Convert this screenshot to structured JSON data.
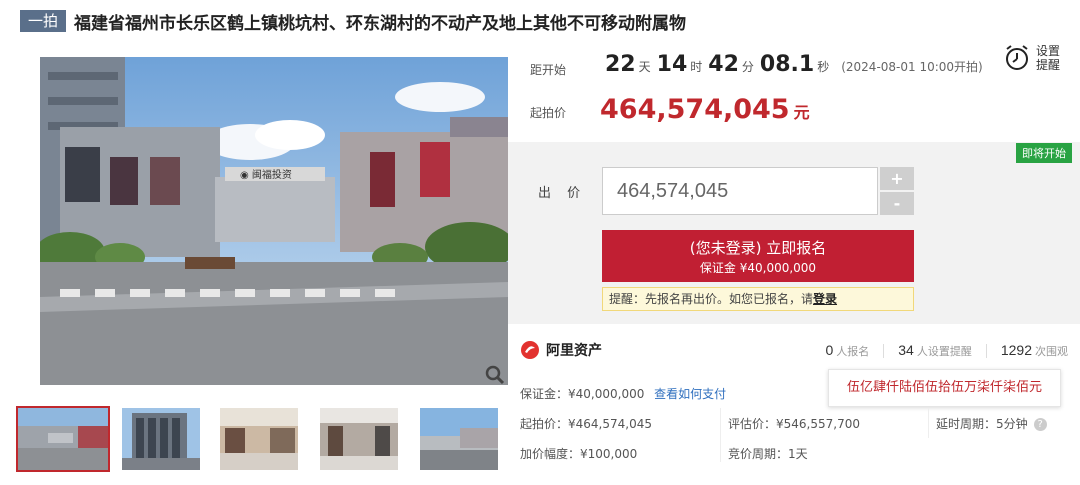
{
  "header": {
    "tag": "一拍",
    "title": "福建省福州市长乐区鹤上镇桃坑村、环东湖村的不动产及地上其他不可移动附属物"
  },
  "countdown": {
    "label": "距开始",
    "days": "22",
    "days_unit": "天",
    "hours": "14",
    "hours_unit": "时",
    "minutes": "42",
    "minutes_unit": "分",
    "seconds": "08.1",
    "seconds_unit": "秒",
    "start_time": "(2024-08-01 10:00开拍)"
  },
  "reminder": {
    "line1": "设置",
    "line2": "提醒",
    "icon": "alarm-clock-icon"
  },
  "start_price": {
    "label": "起拍价",
    "value": "464,574,045",
    "unit": "元"
  },
  "bid": {
    "badge": "即将开始",
    "label": "出 价",
    "value": "464,574,045",
    "plus": "+",
    "minus": "-",
    "signup_main": "(您未登录) 立即报名",
    "signup_sub": "保证金 ¥40,000,000",
    "notice_prefix": "提醒：先报名再出价。如您已报名，请",
    "notice_link": "登录"
  },
  "info": {
    "brand": "阿里资产",
    "stats": [
      {
        "num": "0",
        "text": "人报名"
      },
      {
        "num": "34",
        "text": "人设置提醒"
      },
      {
        "num": "1292",
        "text": "次围观"
      }
    ],
    "deposit": "保证金：¥40,000,000",
    "deposit_link": "查看如何支付",
    "start_price": "起拍价：¥464,574,045",
    "valuation": "评估价：¥546,557,700",
    "delay": "延时周期：5分钟",
    "increment": "加价幅度：¥100,000",
    "cycle": "竞价周期：1天",
    "tooltip": "伍亿肆仟陆佰伍拾伍万柒仟柒佰元"
  },
  "colors": {
    "accent": "#c0282d",
    "button": "#c11f33",
    "badge": "#29a343"
  }
}
